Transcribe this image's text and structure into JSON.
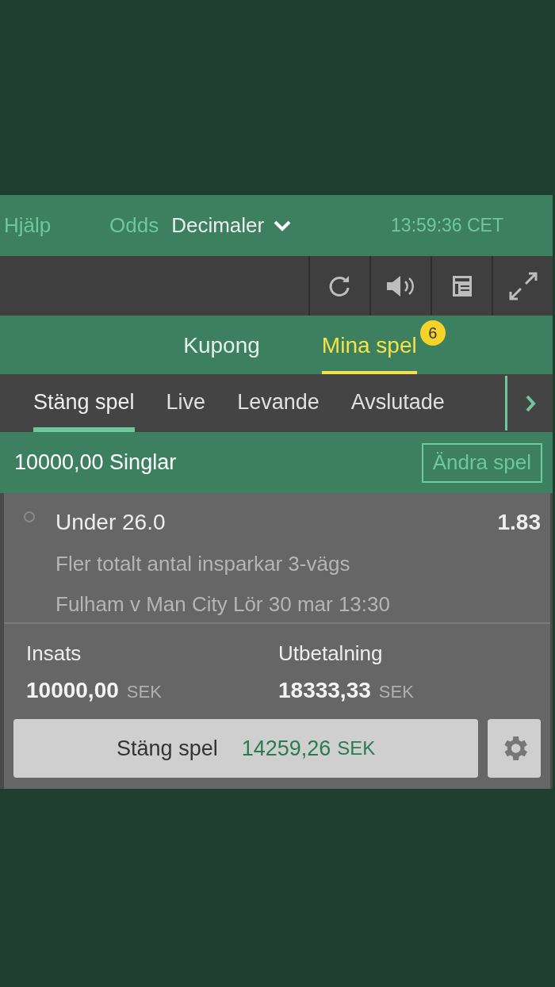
{
  "header": {
    "help_link": "Hjälp",
    "odds_label": "Odds",
    "odds_format": "Decimaler",
    "clock": "13:59:36 CET"
  },
  "toolbar": {
    "buttons": [
      {
        "kind": "refresh"
      },
      {
        "kind": "sound"
      },
      {
        "kind": "calculator"
      },
      {
        "kind": "expand"
      }
    ]
  },
  "tabs": [
    {
      "label": "Kupong",
      "selected": false
    },
    {
      "label": "Mina spel",
      "selected": true,
      "badge": "6"
    }
  ],
  "subtabs": [
    {
      "label": "Stäng spel",
      "selected": true
    },
    {
      "label": "Live",
      "selected": false
    },
    {
      "label": "Levande",
      "selected": false
    },
    {
      "label": "Avslutade",
      "selected": false
    }
  ],
  "bet": {
    "title": "10000,00 Singlar",
    "edit_button": "Ändra spel",
    "selection": {
      "name": "Under 26.0",
      "odds": "1.83",
      "market": "Fler totalt antal insparkar 3-vägs",
      "event": "Fulham v Man City Lör 30 mar 13:30"
    },
    "stake": {
      "label": "Insats",
      "amount": "10000,00",
      "currency": "SEK"
    },
    "payout": {
      "label": "Utbetalning",
      "amount": "18333,33",
      "currency": "SEK"
    },
    "cashout": {
      "label": "Stäng spel",
      "amount": "14259,26",
      "currency": "SEK"
    }
  }
}
